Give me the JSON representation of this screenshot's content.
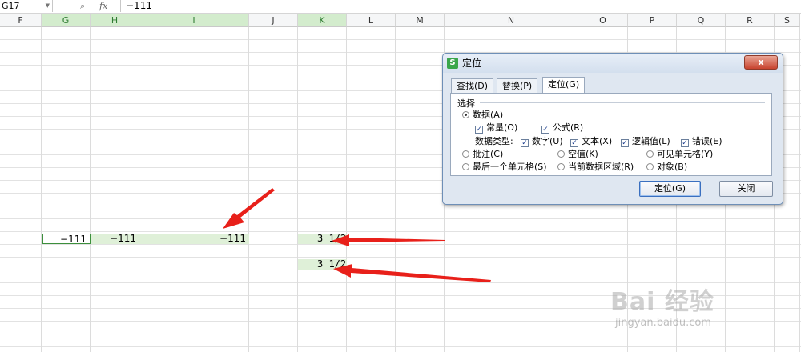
{
  "formula_bar": {
    "cell_ref": "G17",
    "zoom_icon": "zoom-search-icon",
    "fx_label": "fx",
    "value": "−111"
  },
  "columns": [
    "F",
    "G",
    "H",
    "I",
    "J",
    "K",
    "L",
    "M",
    "N",
    "O",
    "P",
    "Q",
    "R",
    "S"
  ],
  "selected_columns": [
    "G",
    "H",
    "I",
    "K"
  ],
  "cells": {
    "g_value": "−111",
    "h_value": "−111",
    "i_value": "−111",
    "k_value_1": "3 1/2",
    "k_value_2": "3 1/2"
  },
  "dialog": {
    "title": "定位",
    "app_icon_letter": "S",
    "close_glyph": "x",
    "tabs": [
      "查找(D)",
      "替换(P)",
      "定位(G)"
    ],
    "active_tab": "定位(G)",
    "group_label": "选择",
    "radio_data": "数据(A)",
    "chk_constants": "常量(O)",
    "chk_formulas": "公式(R)",
    "data_types_label": "数据类型:",
    "chk_numbers": "数字(U)",
    "chk_text": "文本(X)",
    "chk_logical": "逻辑值(L)",
    "chk_errors": "错误(E)",
    "radio_comments": "批注(C)",
    "radio_blanks": "空值(K)",
    "radio_visible": "可见单元格(Y)",
    "radio_last_cell": "最后一个单元格(S)",
    "radio_current_region": "当前数据区域(R)",
    "radio_objects": "对象(B)",
    "btn_goto": "定位(G)",
    "btn_close": "关闭"
  },
  "watermark": {
    "main": "Bai 经验",
    "sub": "jingyan.baidu.com"
  },
  "colors": {
    "selection_green": "#dff0d8",
    "header_green": "#d3eccd",
    "arrow_red": "#e8201a",
    "dialog_bg": "#dfe7f1"
  }
}
